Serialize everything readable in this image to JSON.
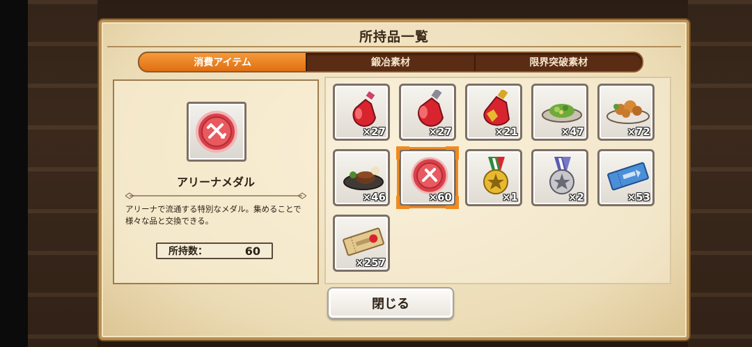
{
  "window": {
    "title": "所持品一覧"
  },
  "tabs": [
    {
      "label": "消費アイテム",
      "active": true
    },
    {
      "label": "鍛冶素材",
      "active": false
    },
    {
      "label": "限界突破素材",
      "active": false
    }
  ],
  "detail": {
    "name": "アリーナメダル",
    "description": "アリーナで流通する特別なメダル。集めることで様々な品と交換できる。",
    "count_label": "所持数：",
    "count_value": "60"
  },
  "items": [
    {
      "icon": "red-potion-small-icon",
      "qty": "×27"
    },
    {
      "icon": "red-potion-large-icon",
      "qty": "×27"
    },
    {
      "icon": "red-potion-gold-icon",
      "qty": "×21"
    },
    {
      "icon": "salad-dish-icon",
      "qty": "×47"
    },
    {
      "icon": "fried-chicken-dish-icon",
      "qty": "×72"
    },
    {
      "icon": "hamburg-steak-dish-icon",
      "qty": "×46"
    },
    {
      "icon": "arena-medal-icon",
      "qty": "×60",
      "selected": true
    },
    {
      "icon": "gold-star-medal-icon",
      "qty": "×1"
    },
    {
      "icon": "silver-star-medal-icon",
      "qty": "×2"
    },
    {
      "icon": "blue-ticket-icon",
      "qty": "×53"
    },
    {
      "icon": "gold-ticket-icon",
      "qty": "×257"
    }
  ],
  "close_button": {
    "label": "閉じる"
  },
  "colors": {
    "accent": "#f08a1e",
    "tab_bg": "#5b2c14",
    "panel_border": "#b98f54"
  }
}
